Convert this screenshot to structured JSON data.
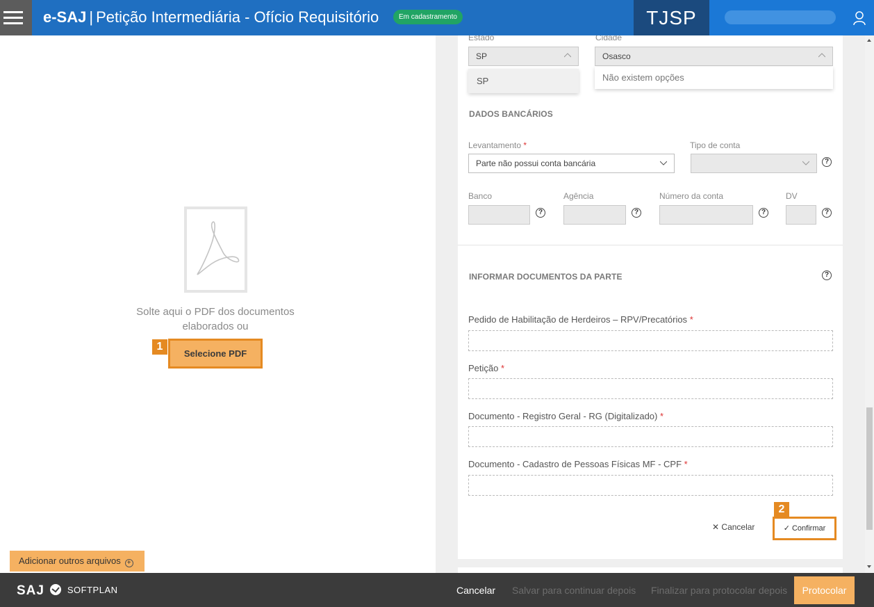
{
  "header": {
    "brand": "e-SAJ",
    "separator": "|",
    "title": "Petição Intermediária - Ofício Requisitório",
    "status_badge": "Em cadastramento",
    "court": "TJSP",
    "menu_icon": "hamburger-icon",
    "user_icon": "user-icon"
  },
  "left": {
    "pdf_icon": "acrobat-pdf-icon",
    "drop_text_line1": "Solte aqui o PDF dos documentos",
    "drop_text_line2": "elaborados ou",
    "select_pdf_label": "Selecione PDF",
    "step1": "1",
    "add_files_label": "Adicionar outros arquivos"
  },
  "form": {
    "estado_label": "Estado",
    "estado_value": "SP",
    "estado_option": "SP",
    "cidade_label": "Cidade",
    "cidade_value": "Osasco",
    "cidade_empty": "Não existem opções",
    "bank_section": "DADOS BANCÁRIOS",
    "levantamento_label": "Levantamento",
    "levantamento_value": "Parte não possui conta bancária",
    "tipo_conta_label": "Tipo de conta",
    "tipo_conta_value": "",
    "banco_label": "Banco",
    "agencia_label": "Agência",
    "numero_conta_label": "Número da conta",
    "dv_label": "DV",
    "docs_section": "INFORMAR DOCUMENTOS DA PARTE",
    "doc1_label": "Pedido de Habilitação de Herdeiros – RPV/Precatórios",
    "doc2_label": "Petição",
    "doc3_label": "Documento - Registro Geral - RG (Digitalizado)",
    "doc4_label": "Documento - Cadastro de Pessoas Físicas MF - CPF",
    "required_mark": "*",
    "help_glyph": "?",
    "cancel_label": "Cancelar",
    "confirm_label": "Confirmar",
    "step2": "2"
  },
  "footer": {
    "logo_saj": "SAJ",
    "logo_softplan": "SOFTPLAN",
    "cancel": "Cancelar",
    "save_later": "Salvar para continuar depois",
    "finalize_later": "Finalizar para protocolar depois",
    "protocolar": "Protocolar"
  },
  "colors": {
    "header_blue": "#1f6fc1",
    "court_blue": "#1b4a7e",
    "badge_green": "#21a464",
    "highlight_orange": "#e58a22",
    "button_orange": "#f5b161",
    "footer_dark": "#3b3b3b"
  }
}
